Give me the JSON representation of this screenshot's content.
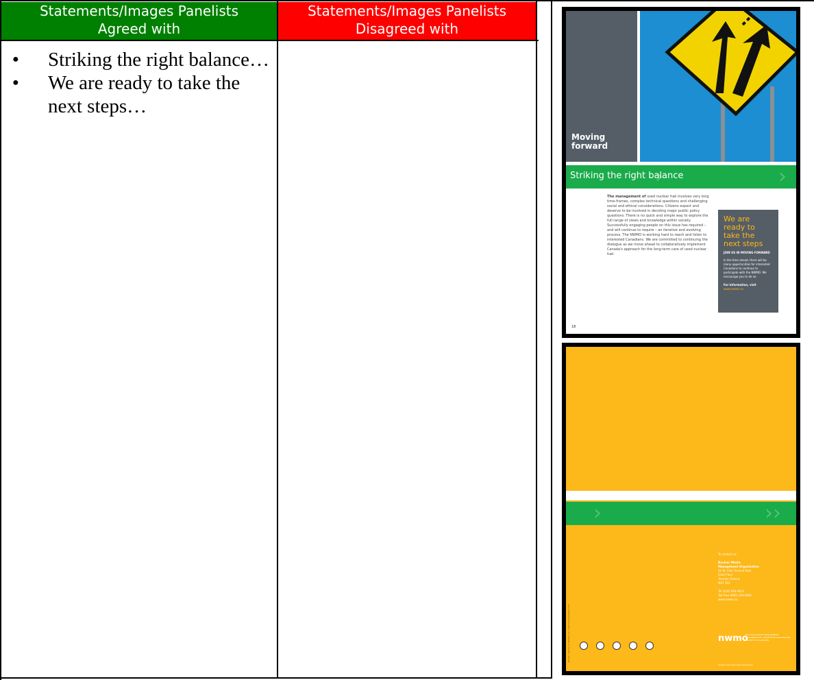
{
  "table": {
    "col_agreed_header": [
      "Statements/Images Panelists",
      "Agreed with"
    ],
    "col_disagreed_header": [
      "Statements/Images Panelists",
      "Disagreed with"
    ],
    "agreed_items": [
      "Striking the right balance…",
      "We are ready to take the next steps…"
    ]
  },
  "page1": {
    "hero_label": [
      "Moving",
      "forward"
    ],
    "band_title": "Striking the right balance",
    "body_lead": "The management of",
    "body_text": "used nuclear fuel involves very long time-frames, complex technical questions and challenging social and ethical considerations. Citizens expect and deserve to be involved in deciding major public policy questions. There is no quick and simple way to explore the full range of views and knowledge within society. Successfully engaging people on this issue has required – and will continue to require – an iterative and evolving process. The NWMO is working hard to reach and listen to interested Canadians. We are committed to continuing the dialogue as we move ahead to collaboratively implement Canada's approach for the long-term care of used nuclear fuel.",
    "box_title": "We are ready to take the next steps",
    "box_sub": "JOIN US IN MOVING FORWARD",
    "box_text": "In the time ahead, there will be many opportunities for interested Canadians to continue to participate with the NWMO. We encourage you to do so.",
    "box_link": "For information, visit",
    "box_url": "www.nwmo.ca",
    "page_number": "18"
  },
  "page2": {
    "contact_intro": "To contact us:",
    "org_name": [
      "Nuclear Waste",
      "Management Organization"
    ],
    "address": [
      "22 St. Clair Avenue East",
      "Sixth Floor",
      "Toronto, Ontario",
      "M4T 2S3"
    ],
    "phone": [
      "Tel (416) 934-9814",
      "Toll Free (866) 249-6966",
      "www.nwmo.ca"
    ],
    "logo": "nwmo",
    "logo_sub": "NUCLEAR WASTE MANAGEMENT ORGANIZATION / SOCIÉTÉ DE GESTION DES DÉCHETS NUCLÉAIRES",
    "note": "Version française aussi disponible",
    "credit": "Design: Hambly & Woolley Inc. www.hamblywoolley.com"
  },
  "colors": {
    "agree_header": "#008000",
    "disagree_header": "#ff0000",
    "nwmo_green": "#1aab4b",
    "nwmo_gray": "#555e66",
    "nwmo_yellow": "#fdb819",
    "sky_blue": "#1c8ed1"
  }
}
